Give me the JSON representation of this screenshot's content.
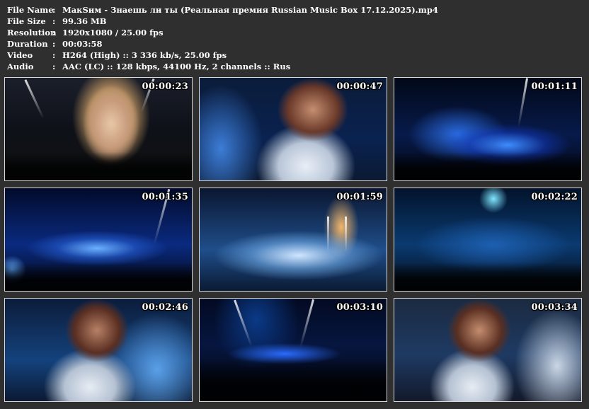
{
  "info": {
    "rows": [
      {
        "key": "File Name",
        "sep": ":",
        "value": "МакSим - Знаешь ли ты (Реальная премия Russian Music Box 17.12.2025).mp4"
      },
      {
        "key": "File Size",
        "sep": ":",
        "value": "99.36 MB"
      },
      {
        "key": "Resolution",
        "sep": ":",
        "value": "1920x1080 / 25.00 fps"
      },
      {
        "key": "Duration",
        "sep": ":",
        "value": "00:03:58"
      },
      {
        "key": "Video",
        "sep": ":",
        "value": "H264 (High) :: 3 336 kb/s, 25.00 fps"
      },
      {
        "key": "Audio",
        "sep": ":",
        "value": "AAC (LC) :: 128 kbps, 44100 Hz, 2 channels :: Rus"
      }
    ]
  },
  "thumbnails": [
    {
      "timestamp": "00:00:23"
    },
    {
      "timestamp": "00:00:47"
    },
    {
      "timestamp": "00:01:11"
    },
    {
      "timestamp": "00:01:35"
    },
    {
      "timestamp": "00:01:59"
    },
    {
      "timestamp": "00:02:22"
    },
    {
      "timestamp": "00:02:46"
    },
    {
      "timestamp": "00:03:10"
    },
    {
      "timestamp": "00:03:34"
    }
  ]
}
